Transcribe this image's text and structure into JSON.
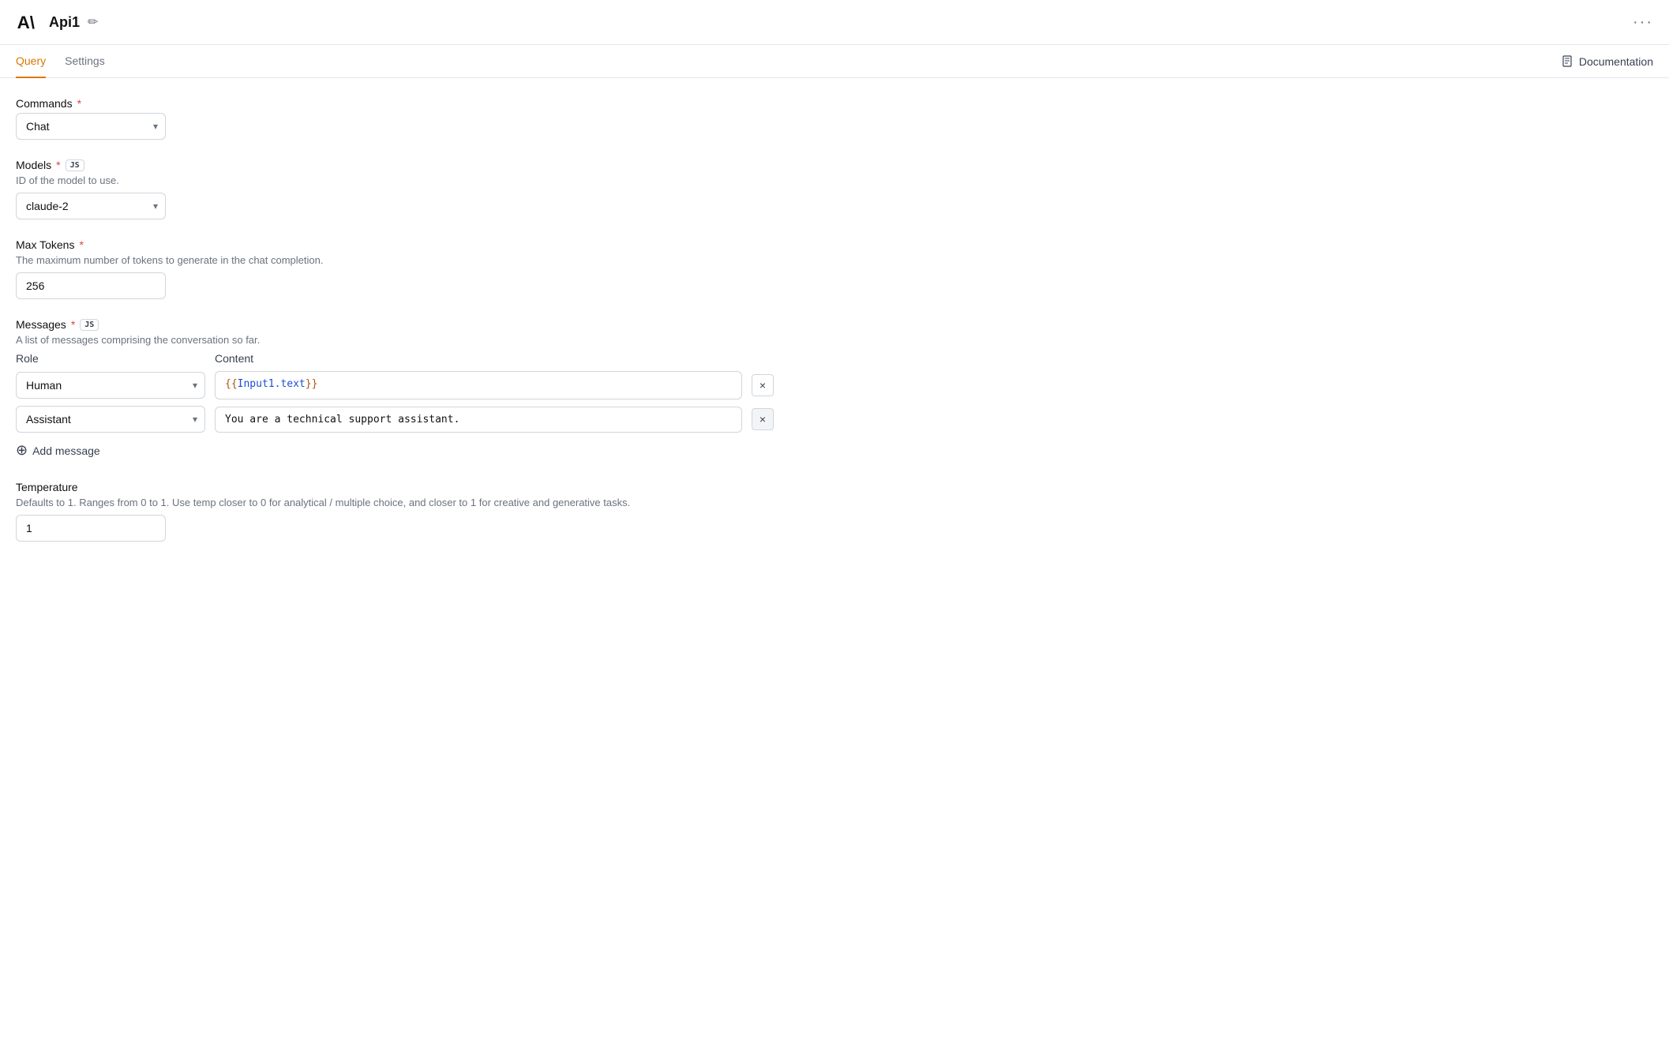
{
  "header": {
    "title": "Api1",
    "more_icon": "···"
  },
  "tabs": {
    "items": [
      {
        "label": "Query",
        "active": true
      },
      {
        "label": "Settings",
        "active": false
      }
    ],
    "docs_label": "Documentation"
  },
  "commands_section": {
    "label": "Commands",
    "required": true,
    "selected_value": "Chat"
  },
  "models_section": {
    "label": "Models",
    "required": true,
    "js_badge": "JS",
    "description": "ID of the model to use.",
    "selected_value": "claude-2"
  },
  "max_tokens_section": {
    "label": "Max Tokens",
    "required": true,
    "description": "The maximum number of tokens to generate in the chat completion.",
    "value": "256"
  },
  "messages_section": {
    "label": "Messages",
    "required": true,
    "js_badge": "JS",
    "description": "A list of messages comprising the conversation so far.",
    "role_col": "Role",
    "content_col": "Content",
    "messages": [
      {
        "role": "Human",
        "content_template_open": "{{",
        "content_template_var": "Input1.text",
        "content_template_close": "}}"
      },
      {
        "role": "Assistant",
        "content": "You are a technical support assistant."
      }
    ],
    "add_message_label": "Add message"
  },
  "temperature_section": {
    "label": "Temperature",
    "description": "Defaults to 1. Ranges from 0 to 1. Use temp closer to 0 for analytical / multiple choice, and closer to 1 for creative and generative tasks.",
    "value": "1"
  }
}
